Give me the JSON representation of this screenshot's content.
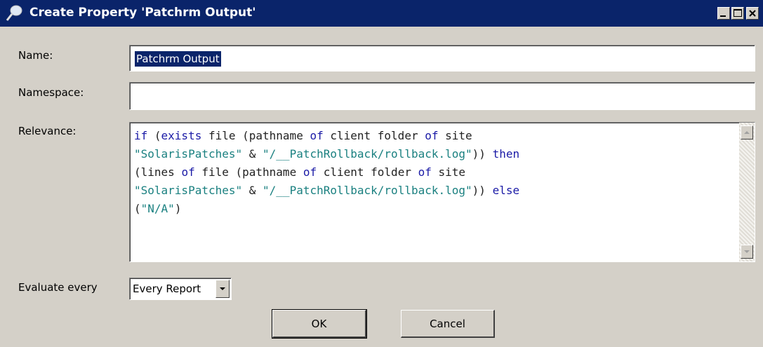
{
  "window": {
    "title": "Create Property 'Patchrm Output'",
    "title_icon": "pushpin-icon"
  },
  "form": {
    "name_label": "Name:",
    "name_value": "Patchrm Output",
    "namespace_label": "Namespace:",
    "namespace_value": "",
    "relevance_label": "Relevance:",
    "evaluate_label": "Evaluate every",
    "evaluate_value": "Every Report"
  },
  "relevance_code": [
    [
      {
        "t": "if",
        "c": "kw"
      },
      {
        "t": " ("
      },
      {
        "t": "exists",
        "c": "kw"
      },
      {
        "t": " file (pathname "
      },
      {
        "t": "of",
        "c": "kw"
      },
      {
        "t": " client folder "
      },
      {
        "t": "of",
        "c": "kw"
      },
      {
        "t": " site"
      }
    ],
    [
      {
        "t": "\"SolarisPatches\"",
        "c": "str"
      },
      {
        "t": " & "
      },
      {
        "t": "\"/__PatchRollback/rollback.log\"",
        "c": "str"
      },
      {
        "t": ")) "
      },
      {
        "t": "then",
        "c": "kw"
      }
    ],
    [
      {
        "t": "(lines "
      },
      {
        "t": "of",
        "c": "kw"
      },
      {
        "t": " file (pathname "
      },
      {
        "t": "of",
        "c": "kw"
      },
      {
        "t": " client folder "
      },
      {
        "t": "of",
        "c": "kw"
      },
      {
        "t": " site"
      }
    ],
    [
      {
        "t": "\"SolarisPatches\"",
        "c": "str"
      },
      {
        "t": " & "
      },
      {
        "t": "\"/__PatchRollback/rollback.log\"",
        "c": "str"
      },
      {
        "t": ")) "
      },
      {
        "t": "else",
        "c": "kw"
      }
    ],
    [
      {
        "t": "("
      },
      {
        "t": "\"N/A\"",
        "c": "str"
      },
      {
        "t": ")"
      }
    ]
  ],
  "buttons": {
    "ok": "OK",
    "cancel": "Cancel"
  },
  "colors": {
    "titlebar": "#0a246a",
    "keyword": "#1a1aa6",
    "string": "#1a8080"
  }
}
